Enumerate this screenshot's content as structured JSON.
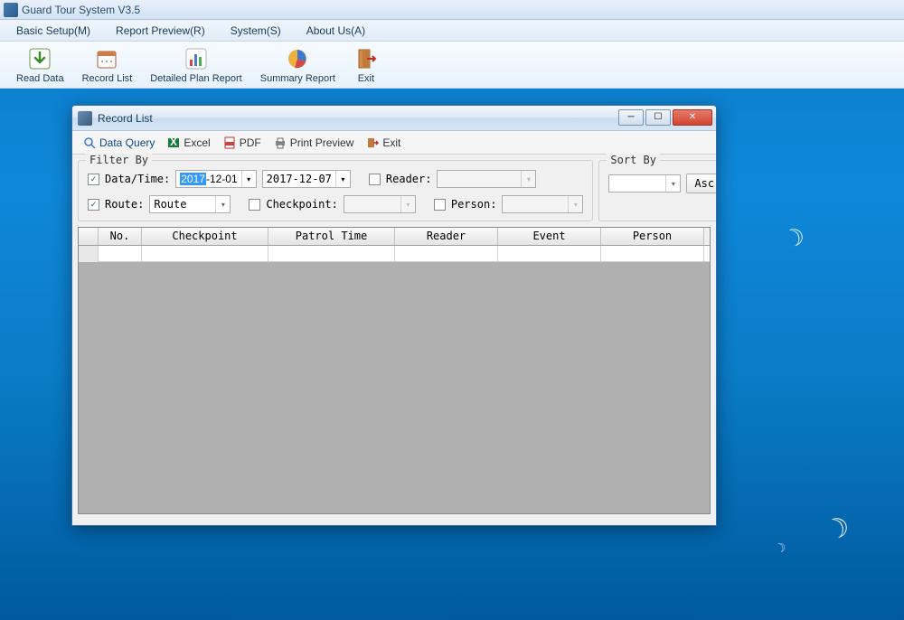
{
  "app": {
    "title": "Guard Tour System V3.5"
  },
  "menu": {
    "items": [
      "Basic Setup(M)",
      "Report Preview(R)",
      "System(S)",
      "About Us(A)"
    ]
  },
  "toolbar": {
    "items": [
      "Read Data",
      "Record List",
      "Detailed Plan Report",
      "Summary Report",
      "Exit"
    ]
  },
  "dialog": {
    "title": "Record List",
    "toolbar": {
      "data_query": "Data Query",
      "excel": "Excel",
      "pdf": "PDF",
      "print": "Print Preview",
      "exit": "Exit"
    },
    "filter": {
      "legend": "Filter By",
      "datetime_label": "Data/Time:",
      "date_from_prefix": "2017",
      "date_from_rest": "-12-01",
      "date_to": "2017-12-07",
      "reader_label": "Reader:",
      "route_label": "Route:",
      "route_value": "Route",
      "checkpoint_label": "Checkpoint:",
      "person_label": "Person:"
    },
    "sort": {
      "legend": "Sort By",
      "order": "Asc"
    },
    "grid": {
      "headers": [
        "",
        "No.",
        "Checkpoint",
        "Patrol Time",
        "Reader",
        "Event",
        "Person"
      ]
    }
  }
}
